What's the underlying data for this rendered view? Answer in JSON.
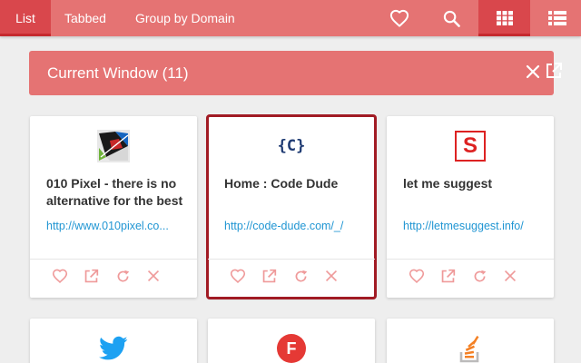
{
  "nav": {
    "tabs": [
      {
        "label": "List",
        "active": true
      },
      {
        "label": "Tabbed",
        "active": false
      },
      {
        "label": "Group by Domain",
        "active": false
      }
    ],
    "icons": {
      "favorites": "heart-icon",
      "search": "search-icon",
      "grid_view": "grid-icon",
      "list_view": "list-icon"
    },
    "active_view": "grid"
  },
  "window": {
    "title": "Current Window (11)",
    "close_icon": "close-icon",
    "open_icon": "open-in-new-icon"
  },
  "cards": [
    {
      "title": "010 Pixel - there is no alternative for the best",
      "url": "http://www.010pixel.co...",
      "favicon": "pixel-logo-icon",
      "selected": false
    },
    {
      "title": "Home : Code Dude",
      "url": "http://code-dude.com/_/",
      "favicon": "code-dude-icon",
      "favicon_text": "{C}",
      "selected": true
    },
    {
      "title": "let me suggest",
      "url": "http://letmesuggest.info/",
      "favicon": "letmesuggest-icon",
      "favicon_text": "S",
      "selected": false
    },
    {
      "title": "",
      "url": "",
      "favicon": "twitter-icon"
    },
    {
      "title": "",
      "url": "",
      "favicon": "f-logo-icon",
      "favicon_text": "F"
    },
    {
      "title": "",
      "url": "",
      "favicon": "stackoverflow-icon"
    }
  ],
  "card_actions": [
    "heart-icon",
    "open-in-new-icon",
    "reload-icon",
    "close-icon"
  ],
  "colors": {
    "primary": "#e57373",
    "primary_dark": "#d9474c",
    "selected_border": "#a11b24",
    "link": "#2196d3",
    "action_icon": "#ef9a9a"
  }
}
